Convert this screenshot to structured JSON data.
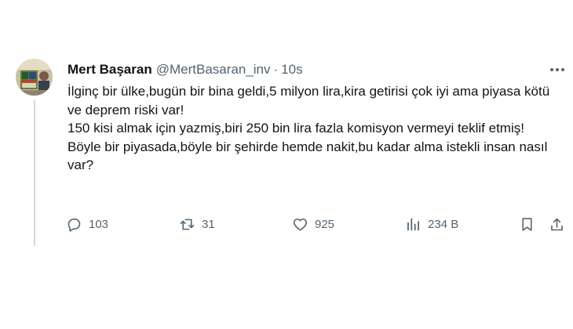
{
  "tweet": {
    "author": {
      "name": "Mert Başaran",
      "handle": "@MertBasaran_inv",
      "separator": "·",
      "time": "10s"
    },
    "text": [
      "İlginç bir ülke,bugün bir bina geldi,5 milyon lira,kira getirisi çok iyi ama piyasa kötü ve deprem riski var!",
      "150 kisi almak için yazmiş,biri 250 bin lira fazla komisyon vermeyi teklif etmiş!",
      "Böyle bir piyasada,böyle bir şehirde hemde nakit,bu kadar alma istekli insan nasıl var?"
    ],
    "actions": {
      "replies": "103",
      "retweets": "31",
      "likes": "925",
      "views": "234 B"
    },
    "icons": {
      "more": "more-horizontal-icon",
      "reply": "reply-icon",
      "retweet": "retweet-icon",
      "like": "heart-icon",
      "views": "analytics-icon",
      "bookmark": "bookmark-icon",
      "share": "share-icon"
    },
    "colors": {
      "text": "#0f1419",
      "secondary": "#536471",
      "thread_line": "#cfd9de"
    }
  }
}
